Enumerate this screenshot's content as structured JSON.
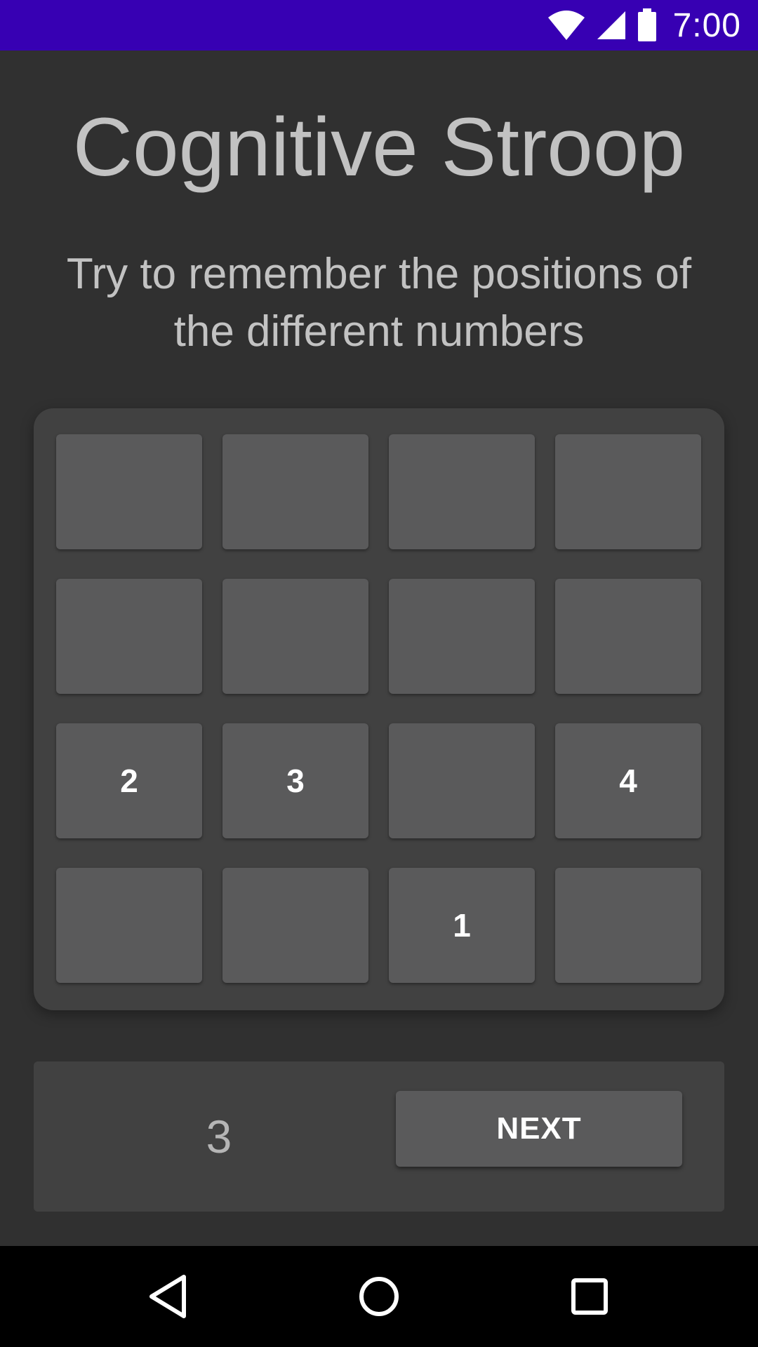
{
  "status_bar": {
    "time": "7:00",
    "icons": [
      "wifi-icon",
      "cell-signal-icon",
      "battery-icon"
    ]
  },
  "app": {
    "title": "Cognitive Stroop",
    "instructions": "Try to remember the positions of the different numbers"
  },
  "grid": {
    "rows": [
      [
        "",
        "",
        "",
        ""
      ],
      [
        "",
        "",
        "",
        ""
      ],
      [
        "2",
        "3",
        "",
        "4"
      ],
      [
        "",
        "",
        "1",
        ""
      ]
    ]
  },
  "footer": {
    "counter": "3",
    "next_label": "NEXT"
  },
  "navigation": {
    "buttons": [
      "back-icon",
      "home-icon",
      "recents-icon"
    ]
  },
  "colors": {
    "status_bar": "#3700b3",
    "background": "#303030",
    "card": "#414141",
    "tile": "#5a5a5b",
    "text_muted": "#c2c2c2"
  }
}
